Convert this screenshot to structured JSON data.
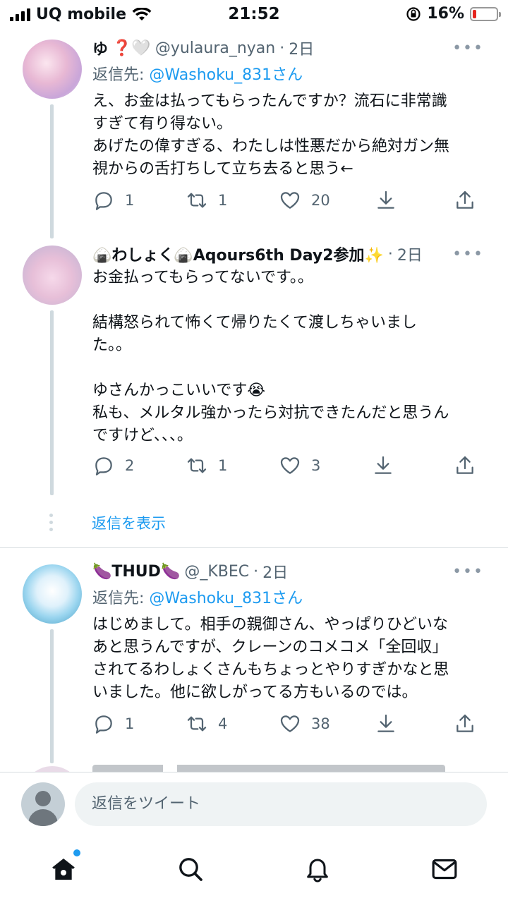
{
  "status_bar": {
    "carrier": "UQ mobile",
    "time": "21:52",
    "battery_percent": "16%",
    "battery_level": 0.16
  },
  "tweets": [
    {
      "name": "ゆ",
      "badges": "❓🤍",
      "handle": "@yulaura_nyan",
      "time": "2日",
      "reply_prefix": "返信先:",
      "reply_to": "@Washoku_831さん",
      "text": "え、お金は払ってもらったんですか？流石に非常識\nすぎて有り得ない。\nあげたの偉すぎる、わたしは性悪だから絶対ガン無\n視からの舌打ちして立ち去ると思う←",
      "replies": "1",
      "retweets": "1",
      "likes": "20"
    },
    {
      "name": "🍙わしょく🍙Aqours6th Day2参加✨",
      "handle": "",
      "time": "2日",
      "text": "お金払ってもらってないです。。\n\n結構怒られて怖くて帰りたくて渡しちゃいまし\nた。。\n\nゆさんかっこいいです😭\n私も、メルタル強かったら対抗できたんだと思うん\nですけど、、、。",
      "replies": "2",
      "retweets": "1",
      "likes": "3"
    },
    {
      "name": "🍆THUD🍆",
      "handle": "@_KBEC",
      "time": "2日",
      "reply_prefix": "返信先:",
      "reply_to": "@Washoku_831さん",
      "text": "はじめまして。相手の親御さん、やっぱりひどいな\nあと思うんですが、クレーンのコメコメ「全回収」\nされてるわしょくさんもちょっとやりすぎかなと思\nいました。他に欲しがってる方もいるのでは。",
      "replies": "1",
      "retweets": "4",
      "likes": "38"
    }
  ],
  "show_replies": "返信を表示",
  "more_symbol": "•••",
  "composer": {
    "placeholder": "返信をツイート"
  },
  "nav": {
    "icons": [
      "home-icon",
      "search-icon",
      "notifications-icon",
      "messages-icon"
    ]
  },
  "colors": {
    "accent": "#1d9bf0",
    "muted": "#536471",
    "battery_low": "#e5241e"
  }
}
